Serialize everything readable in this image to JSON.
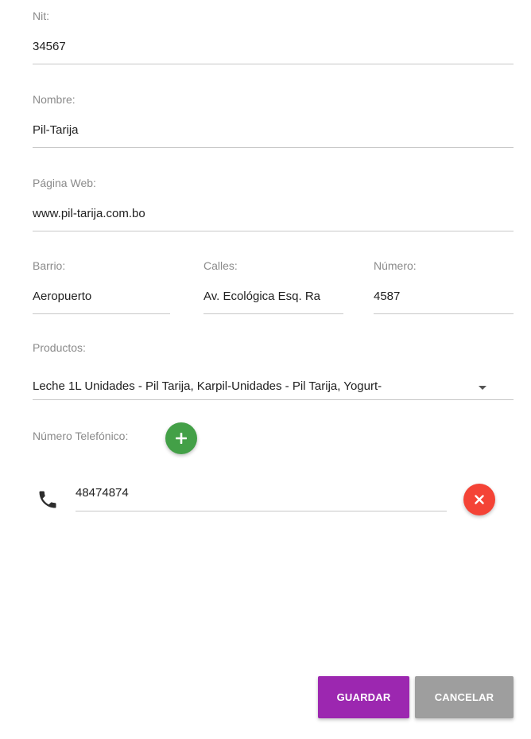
{
  "form": {
    "nit": {
      "label": "Nit:",
      "value": "34567"
    },
    "nombre": {
      "label": "Nombre:",
      "value": "Pil-Tarija"
    },
    "pagina_web": {
      "label": "Página Web:",
      "value": "www.pil-tarija.com.bo"
    },
    "barrio": {
      "label": "Barrio:",
      "value": "Aeropuerto"
    },
    "calles": {
      "label": "Calles:",
      "value": "Av. Ecológica Esq. Ra"
    },
    "numero": {
      "label": "Número:",
      "value": "4587"
    },
    "productos": {
      "label": "Productos:",
      "selected": "Leche 1L Unidades - Pil Tarija, Karpil-Unidades - Pil Tarija, Yogurt-"
    },
    "telefonos": {
      "label": "Número Telefónico:",
      "items": [
        {
          "value": "48474874"
        }
      ]
    }
  },
  "actions": {
    "save_label": "GUARDAR",
    "cancel_label": "CANCELAR"
  },
  "colors": {
    "save_button": "#9c27b0",
    "cancel_button": "#9e9e9e",
    "add_button": "#43a047",
    "remove_button": "#f44336"
  },
  "icons": {
    "add": "plus-icon",
    "remove": "close-icon",
    "phone": "phone-icon",
    "dropdown": "chevron-down-icon"
  }
}
